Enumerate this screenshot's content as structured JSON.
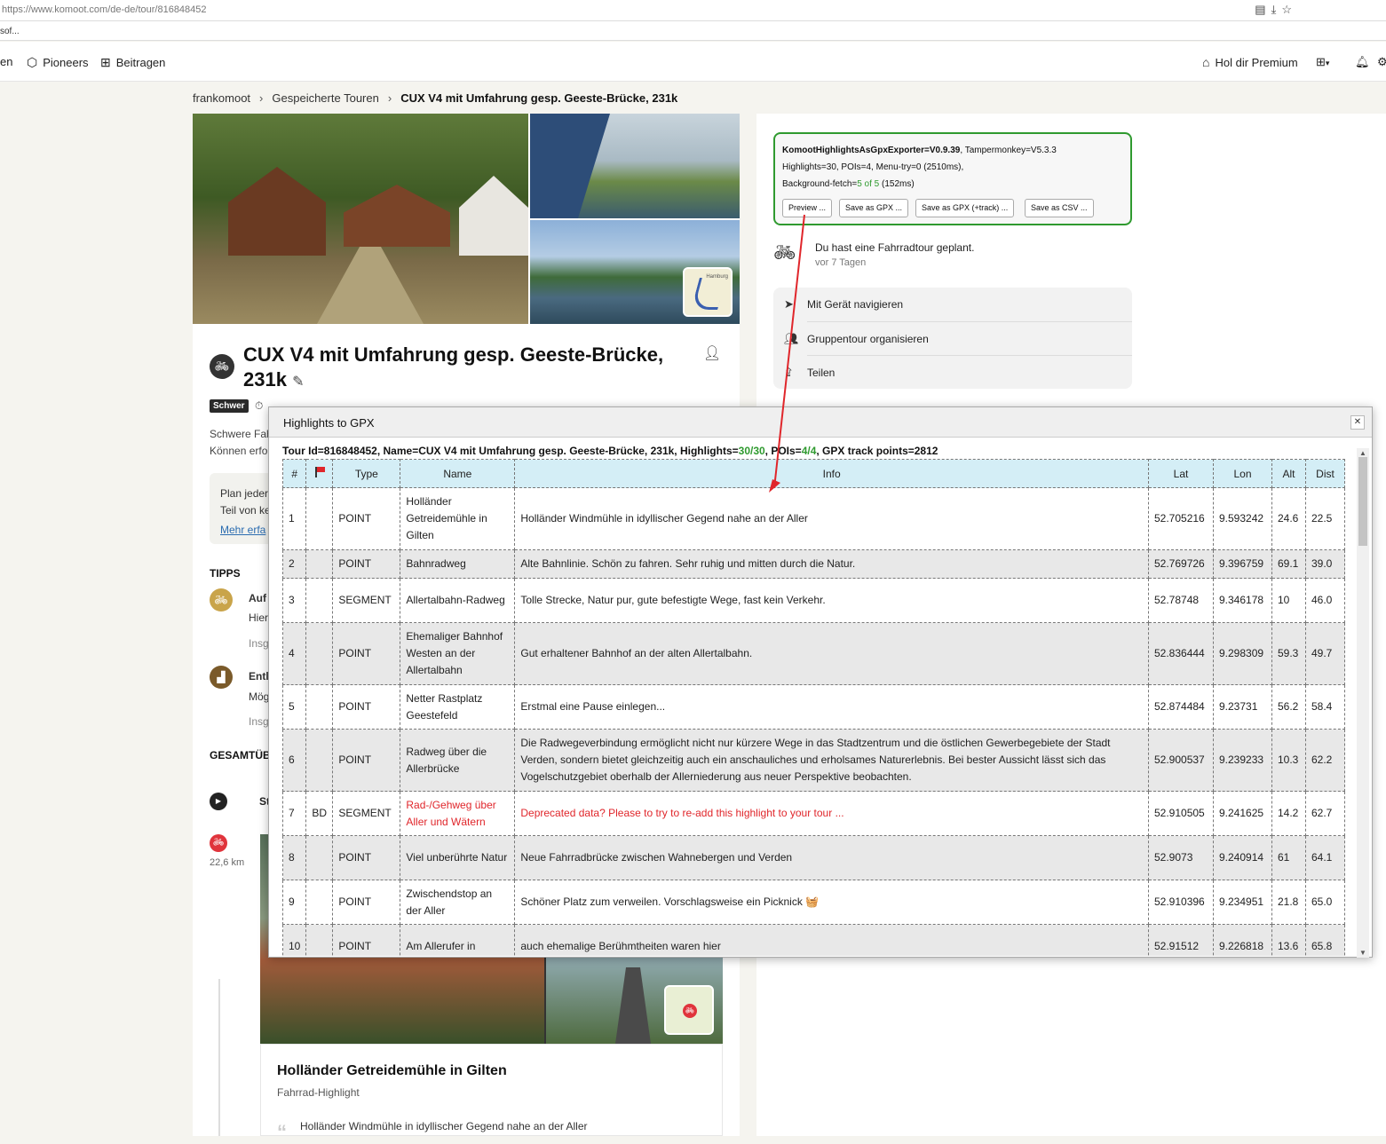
{
  "browser": {
    "url": "https://www.komoot.com/de-de/tour/816848452",
    "bookmark": "sof..."
  },
  "nav": {
    "left_partial": "en",
    "pioneers": "Pioneers",
    "contribute": "Beitragen",
    "premium": "Hol dir Premium"
  },
  "breadcrumb": [
    "frankomoot",
    "Gespeicherte Touren",
    "CUX V4 mit Umfahrung gesp. Geeste-Brücke, 231k"
  ],
  "tour": {
    "title": "CUX V4 mit Umfahrung gesp. Geeste-Brücke, 231k",
    "difficulty": "Schwer",
    "desc1": "Schwere Fah",
    "desc2": "Können erfo",
    "info1": "Plan jeder",
    "info2": "Teil von ke",
    "info_link": "Mehr erfa",
    "tips_heading": "TIPPS",
    "tip1": "Auf",
    "tip1_sub1": "Hier",
    "tip1_sub2": "Insg",
    "tip2": "Entl",
    "tip2_sub1": "Mög",
    "tip2_sub2": "Insg",
    "overview_heading": "GESAMTÜB",
    "start_partial": "St",
    "distance": "22,6 km",
    "minimap_label": "Hamburg"
  },
  "highlight_card": {
    "title": "Holländer Getreidemühle in Gilten",
    "subtitle": "Fahrrad-Highlight",
    "quote": "Holländer Windmühle in idyllischer Gegend nahe an der Aller"
  },
  "exporter": {
    "name": "KomootHighlightsAsGpxExporter=V0.9.39",
    "tm": ", Tampermonkey=V5.3.3",
    "line2": "Highlights=30, POIs=4, Menu-try=0 (2510ms),",
    "line3a": "Background-fetch=",
    "line3b": "5 of 5",
    "line3c": " (152ms)",
    "buttons": [
      "Preview ...",
      "Save as GPX ...",
      "Save as GPX (+track) ...",
      "Save as CSV ..."
    ]
  },
  "planned": {
    "text": "Du hast eine Fahrradtour geplant.",
    "when": "vor 7 Tagen"
  },
  "actions": [
    "Mit Gerät navigieren",
    "Gruppentour organisieren",
    "Teilen"
  ],
  "dialog": {
    "title": "Highlights to GPX",
    "summary_a": "Tour Id=816848452, Name=CUX V4 mit Umfahrung gesp. Geeste-Brücke, 231k, Highlights=",
    "summary_b": "30/30",
    "summary_c": ", POIs=",
    "summary_d": "4/4",
    "summary_e": ", GPX track points=2812",
    "headers": [
      "#",
      "",
      "Type",
      "Name",
      "Info",
      "Lat",
      "Lon",
      "Alt",
      "Dist"
    ],
    "rows": [
      {
        "n": "1",
        "flag": "",
        "type": "POINT",
        "name": "Holländer Getreidemühle in Gilten",
        "info": "Holländer Windmühle in idyllischer Gegend nahe an der Aller",
        "lat": "52.705216",
        "lon": "9.593242",
        "alt": "24.6",
        "dist": "22.5"
      },
      {
        "n": "2",
        "flag": "",
        "type": "POINT",
        "name": "Bahnradweg",
        "info": "Alte Bahnlinie. Schön zu fahren. Sehr ruhig und mitten durch die Natur.",
        "lat": "52.769726",
        "lon": "9.396759",
        "alt": "69.1",
        "dist": "39.0"
      },
      {
        "n": "3",
        "flag": "",
        "type": "SEGMENT",
        "name": "Allertalbahn-Radweg",
        "info": "Tolle Strecke, Natur pur, gute befestigte Wege, fast kein Verkehr.",
        "lat": "52.78748",
        "lon": "9.346178",
        "alt": "10",
        "dist": "46.0"
      },
      {
        "n": "4",
        "flag": "",
        "type": "POINT",
        "name": "Ehemaliger Bahnhof Westen an der Allertalbahn",
        "info": "Gut erhaltener Bahnhof an der alten Allertalbahn.",
        "lat": "52.836444",
        "lon": "9.298309",
        "alt": "59.3",
        "dist": "49.7"
      },
      {
        "n": "5",
        "flag": "",
        "type": "POINT",
        "name": "Netter Rastplatz Geestefeld",
        "info": "Erstmal eine Pause einlegen...",
        "lat": "52.874484",
        "lon": "9.23731",
        "alt": "56.2",
        "dist": "58.4"
      },
      {
        "n": "6",
        "flag": "",
        "type": "POINT",
        "name": "Radweg über die Allerbrücke",
        "info": "Die Radwegeverbindung ermöglicht nicht nur kürzere Wege in das Stadtzentrum und die östlichen Gewerbegebiete der Stadt Verden, sondern bietet gleichzeitig auch ein anschauliches und erholsames Naturerlebnis. Bei bester Aussicht lässt sich das Vogelschutzgebiet oberhalb der Allerniederung aus neuer Perspektive beobachten.",
        "lat": "52.900537",
        "lon": "9.239233",
        "alt": "10.3",
        "dist": "62.2"
      },
      {
        "n": "7",
        "flag": "BD",
        "type": "SEGMENT",
        "name": "Rad-/Gehweg über Aller und Wätern",
        "info": "Deprecated data? Please to try to re-add this highlight to your tour ...",
        "lat": "52.910505",
        "lon": "9.241625",
        "alt": "14.2",
        "dist": "62.7"
      },
      {
        "n": "8",
        "flag": "",
        "type": "POINT",
        "name": "Viel unberührte Natur",
        "info": "Neue Fahrradbrücke zwischen Wahnebergen und Verden",
        "lat": "52.9073",
        "lon": "9.240914",
        "alt": "61",
        "dist": "64.1"
      },
      {
        "n": "9",
        "flag": "",
        "type": "POINT",
        "name": "Zwischendstop an der Aller",
        "info": "Schöner Platz zum verweilen. Vorschlagsweise ein Picknick 🧺",
        "lat": "52.910396",
        "lon": "9.234951",
        "alt": "21.8",
        "dist": "65.0"
      },
      {
        "n": "10",
        "flag": "",
        "type": "POINT",
        "name": "Am Allerufer in",
        "info": "auch ehemalige Berühmtheiten waren hier",
        "lat": "52.91512",
        "lon": "9.226818",
        "alt": "13.6",
        "dist": "65.8"
      }
    ]
  },
  "colors": {
    "accent_green": "#2f9a2f",
    "warning_red": "#e0262b",
    "table_header": "#d4eef6"
  }
}
